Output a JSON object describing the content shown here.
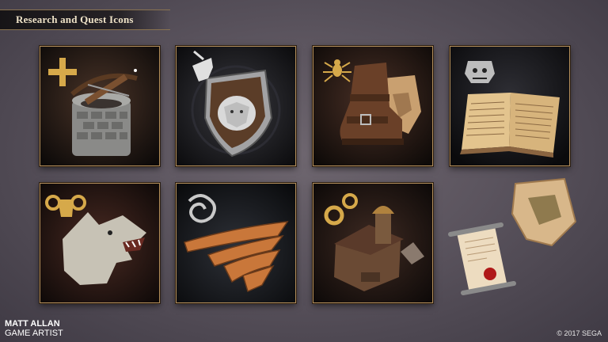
{
  "header": {
    "title": "Research and Quest Icons"
  },
  "icons": [
    {
      "name": "ballista-tower-icon",
      "badge": "plus-icon"
    },
    {
      "name": "wolf-shield-icon",
      "badge": "unicorn-icon"
    },
    {
      "name": "boot-and-map-icon",
      "badge": "spider-icon"
    },
    {
      "name": "open-book-icon",
      "badge": "ogre-skull-icon"
    },
    {
      "name": "wolf-head-icon",
      "badge": "ram-skull-icon"
    },
    {
      "name": "bronze-wings-icon",
      "badge": "dragon-emblem-icon"
    },
    {
      "name": "workshop-building-icon",
      "badge": "gears-icon"
    },
    {
      "name": "scroll-and-map-icon"
    }
  ],
  "footer": {
    "artist_name": "MATT ALLAN",
    "artist_role": "GAME ARTIST",
    "copyright": "© 2017 SEGA"
  },
  "colors": {
    "background": "#5b545e",
    "frame": "#b38e5a",
    "gold": "#d6a94a",
    "silver": "#c9c9c9"
  }
}
